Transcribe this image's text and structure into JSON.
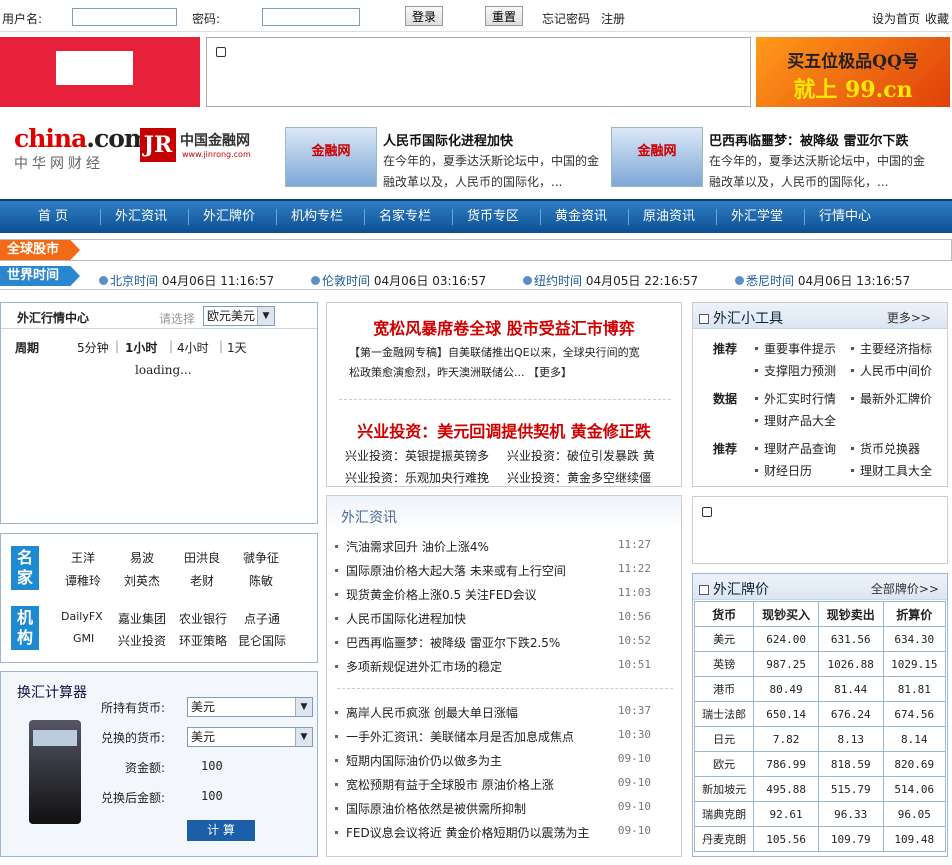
{
  "login": {
    "user_label": "用户名:",
    "pass_label": "密码:",
    "login_btn": "登录",
    "reset_btn": "重置",
    "forgot": "忘记密码",
    "register": "注册",
    "set_home": "设为首页",
    "favorite": "收藏"
  },
  "ad_right": {
    "line1": "买五位极品QQ号",
    "line2": "就上 99.cn"
  },
  "logo": {
    "china_a": "china",
    "china_b": ".com",
    "china_sub": "中华网财经",
    "jr_mark": "JR",
    "jr_name": "中国金融网",
    "jr_url": "www.jinrong.com"
  },
  "headlines": [
    {
      "img_text": "金融网",
      "title": "人民币国际化进程加快",
      "body1": "在今年的，夏季达沃斯论坛中，中国的金",
      "body2": "融改革以及，人民币的国际化，..."
    },
    {
      "img_text": "金融网",
      "title": "巴西再临噩梦：被降级 雷亚尔下跌",
      "body1": "在今年的，夏季达沃斯论坛中，中国的金",
      "body2": "融改革以及，人民币的国际化，..."
    }
  ],
  "nav": [
    "首 页",
    "外汇资讯",
    "外汇牌价",
    "机构专栏",
    "名家专栏",
    "货币专区",
    "黄金资讯",
    "原油资讯",
    "外汇学堂",
    "行情中心"
  ],
  "bars": {
    "global_stock": "全球股市",
    "world_time": "世界时间",
    "times": [
      {
        "city": "北京时间",
        "date": "04月06日",
        "time": "11:16:57"
      },
      {
        "city": "伦敦时间",
        "date": "04月06日",
        "time": "03:16:57"
      },
      {
        "city": "纽约时间",
        "date": "04月05日",
        "time": "22:16:57"
      },
      {
        "city": "悉尼时间",
        "date": "04月06日",
        "time": "13:16:57"
      }
    ]
  },
  "market_center": {
    "title": "外汇行情中心",
    "choose": "请选择",
    "pair": "欧元美元",
    "period_label": "周期",
    "periods": [
      "5分钟",
      "1小时",
      "4小时",
      "1天"
    ],
    "loading": "loading..."
  },
  "experts": {
    "fam_label_a": "名家",
    "fam_label_b": "机构",
    "names": [
      "王洋",
      "易波",
      "田洪良",
      "虢争征",
      "谭稚玲",
      "刘英杰",
      "老财",
      "陈敏"
    ],
    "orgs": [
      "DailyFX",
      "嘉业集团",
      "农业银行",
      "点子通",
      "GMI",
      "兴业投资",
      "环亚策略",
      "昆仑国际"
    ]
  },
  "calculator": {
    "title": "换汇计算器",
    "have_label": "所持有货币:",
    "have_value": "美元",
    "to_label": "兑换的货币:",
    "to_value": "美元",
    "amount_label": "资金额:",
    "amount_value": "100",
    "result_label": "兑换后金额:",
    "result_value": "100",
    "calc_btn": "计 算"
  },
  "top_news": {
    "headline1": "宽松风暴席卷全球 股市受益汇市博弈",
    "summary1": "【第一金融网专稿】自美联储推出QE以来，全球央行间的宽",
    "summary2": "松政策愈演愈烈，昨天澳洲联储公...",
    "more": "【更多】",
    "headline2": "兴业投资：美元回调提供契机 黄金修正跌",
    "links": [
      "兴业投资：英银提振英镑多",
      "兴业投资：破位引发暴跌 黄",
      "兴业投资：乐观加央行难挽",
      "兴业投资：黄金多空继续僵"
    ]
  },
  "fx_news": {
    "title": "外汇资讯",
    "items_a": [
      {
        "title": "汽油需求回升 油价上涨4%",
        "time": "11:27"
      },
      {
        "title": "国际原油价格大起大落 未来或有上行空间",
        "time": "11:22"
      },
      {
        "title": "现货黄金价格上涨0.5 关注FED会议",
        "time": "11:03"
      },
      {
        "title": "人民币国际化进程加快",
        "time": "10:56"
      },
      {
        "title": "巴西再临噩梦：被降级 雷亚尔下跌2.5%",
        "time": "10:52"
      },
      {
        "title": "多项新规促进外汇市场的稳定",
        "time": "10:51"
      }
    ],
    "items_b": [
      {
        "title": "离岸人民币疯涨 创最大单日涨幅",
        "time": "10:37"
      },
      {
        "title": "一手外汇资讯：美联储本月是否加息成焦点",
        "time": "10:30"
      },
      {
        "title": "短期内国际油价仍以做多为主",
        "time": "09-10"
      },
      {
        "title": "宽松预期有益于全球股市 原油价格上涨",
        "time": "09-10"
      },
      {
        "title": "国际原油价格依然是被供需所抑制",
        "time": "09-10"
      },
      {
        "title": "FED议息会议将近 黄金价格短期仍以震荡为主",
        "time": "09-10"
      }
    ]
  },
  "tools": {
    "title": "外汇小工具",
    "more": "更多>>",
    "groups": [
      {
        "label": "推荐",
        "items": [
          "重要事件提示",
          "主要经济指标",
          "支撑阻力预测",
          "人民币中间价"
        ]
      },
      {
        "label": "数据",
        "items": [
          "外汇实时行情",
          "最新外汇牌价",
          "理财产品大全"
        ]
      },
      {
        "label": "推荐",
        "items": [
          "理财产品查询",
          "货币兑换器",
          "财经日历",
          "理财工具大全"
        ]
      }
    ]
  },
  "rates": {
    "title": "外汇牌价",
    "more": "全部牌价>>",
    "headers": [
      "货币",
      "现钞买入",
      "现钞卖出",
      "折算价"
    ],
    "rows": [
      [
        "美元",
        "624.00",
        "631.56",
        "634.30"
      ],
      [
        "英镑",
        "987.25",
        "1026.88",
        "1029.15"
      ],
      [
        "港币",
        "80.49",
        "81.44",
        "81.81"
      ],
      [
        "瑞士法郎",
        "650.14",
        "676.24",
        "674.56"
      ],
      [
        "日元",
        "7.82",
        "8.13",
        "8.14"
      ],
      [
        "欧元",
        "786.99",
        "818.59",
        "820.69"
      ],
      [
        "新加坡元",
        "495.88",
        "515.79",
        "514.06"
      ],
      [
        "瑞典克朗",
        "92.61",
        "96.33",
        "96.05"
      ],
      [
        "丹麦克朗",
        "105.56",
        "109.79",
        "109.48"
      ]
    ]
  },
  "colors": {
    "accent": "#0d4f92",
    "red": "#d00000",
    "orange_tag": "#f26a16",
    "blue_tag": "#2b86d0"
  }
}
